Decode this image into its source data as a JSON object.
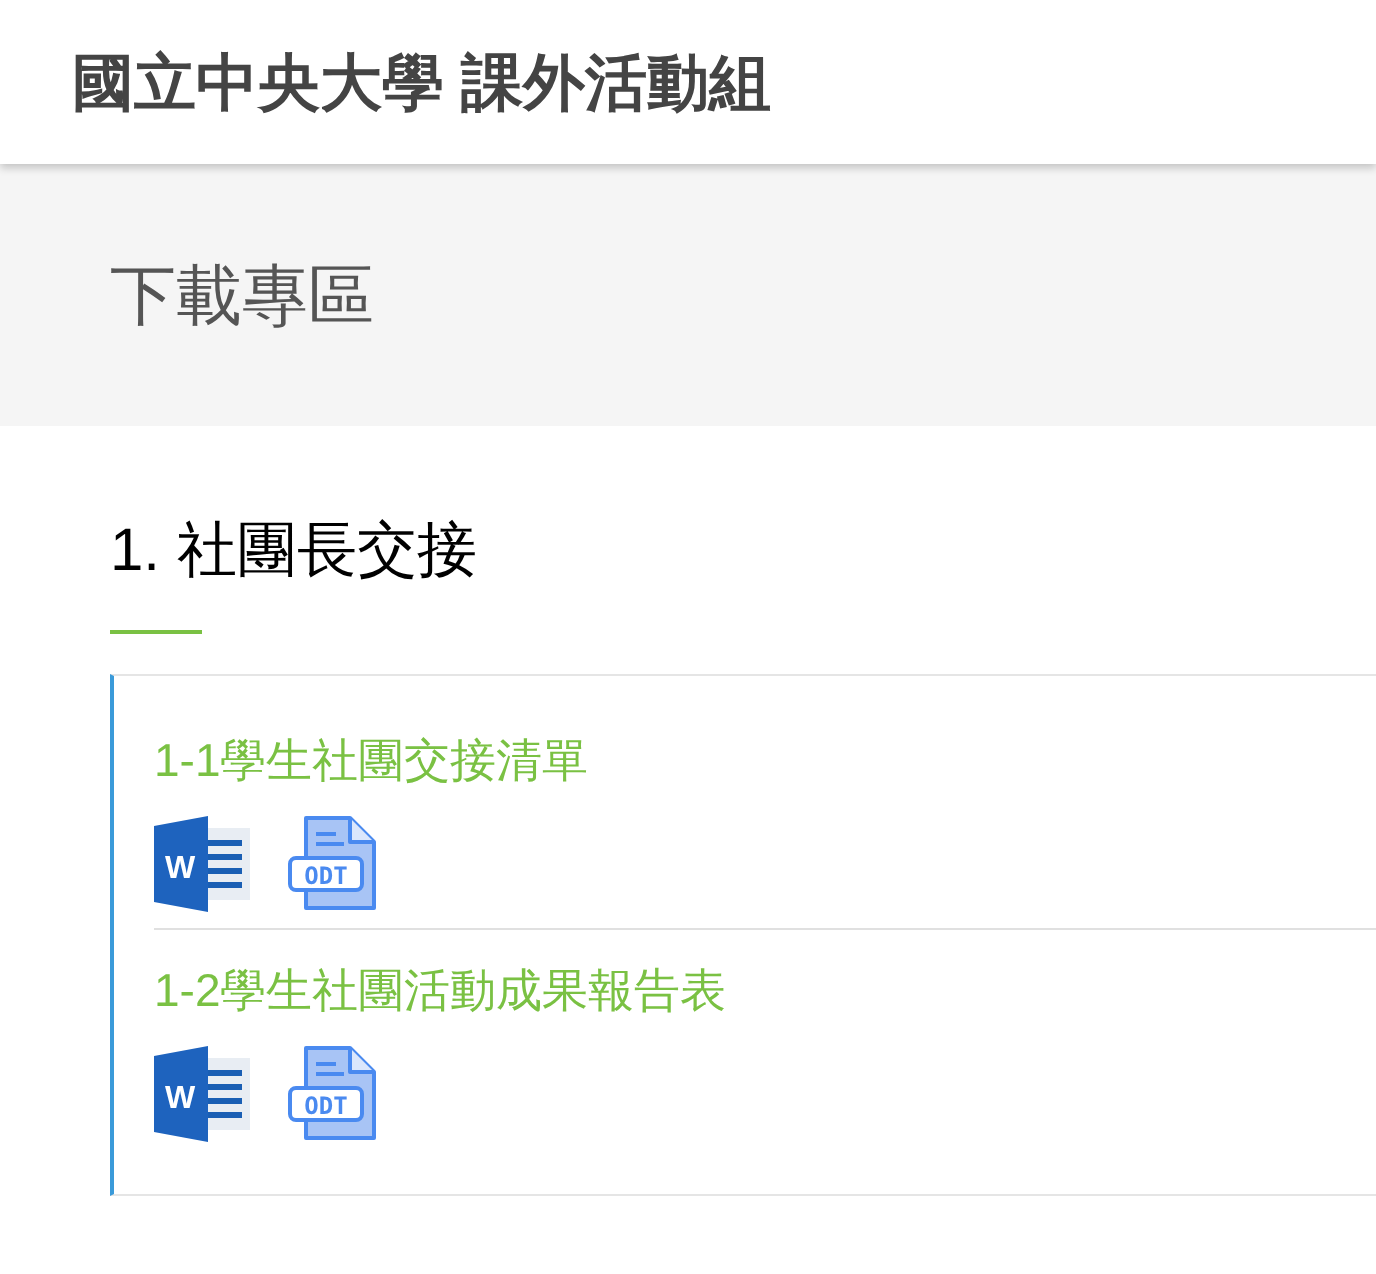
{
  "header": {
    "title": "國立中央大學 課外活動組"
  },
  "banner": {
    "title": "下載專區"
  },
  "section": {
    "heading": "1. 社團長交接",
    "items": [
      {
        "title": "1-1學生社團交接清單",
        "files": [
          {
            "kind": "word",
            "label": "W"
          },
          {
            "kind": "odt",
            "label": "ODT"
          }
        ]
      },
      {
        "title": "1-2學生社團活動成果報告表",
        "files": [
          {
            "kind": "word",
            "label": "W"
          },
          {
            "kind": "odt",
            "label": "ODT"
          }
        ]
      }
    ]
  }
}
